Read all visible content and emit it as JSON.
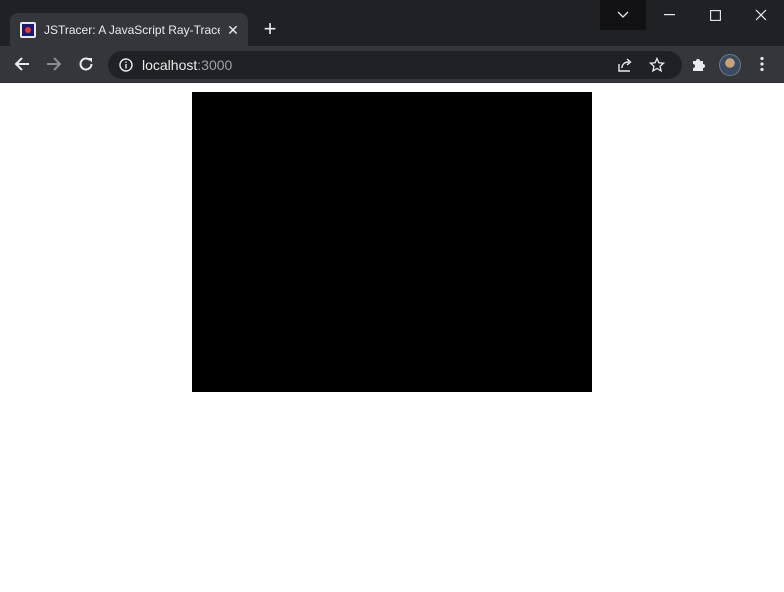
{
  "browser": {
    "tab": {
      "title": "JSTracer: A JavaScript Ray-Tracer",
      "close_label": "✕"
    },
    "new_tab_label": "+",
    "address_bar": {
      "host": "localhost",
      "port": ":3000"
    },
    "icons": {
      "dropdown": "chevron-down-icon",
      "minimize": "minimize-icon",
      "maximize": "maximize-icon",
      "close": "close-icon",
      "back": "back-arrow-icon",
      "forward": "forward-arrow-icon",
      "reload": "reload-icon",
      "info": "info-icon",
      "share": "share-icon",
      "bookmark": "star-icon",
      "extensions": "puzzle-icon",
      "profile": "avatar",
      "menu": "kebab-menu-icon"
    },
    "colors": {
      "tabstrip": "#202124",
      "toolbar": "#35363a",
      "omnibox": "#202124",
      "text": "#e8eaed",
      "port_text": "#9aa0a6"
    }
  },
  "page": {
    "canvas_color": "#000000",
    "background": "#ffffff"
  }
}
